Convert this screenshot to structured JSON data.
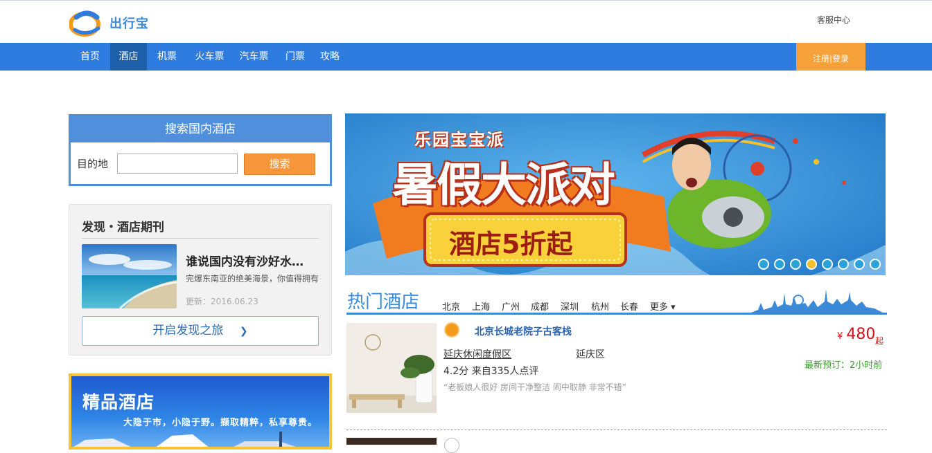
{
  "header": {
    "brand": "出行宝",
    "service_link": "客服中心"
  },
  "nav": {
    "items": [
      {
        "label": "首页"
      },
      {
        "label": "酒店",
        "active": true
      },
      {
        "label": "机票"
      },
      {
        "label": "火车票"
      },
      {
        "label": "汽车票"
      },
      {
        "label": "门票"
      },
      {
        "label": "攻略"
      }
    ],
    "login": "注册|登录"
  },
  "search": {
    "title": "搜索国内酒店",
    "label": "目的地",
    "value": "",
    "button": "搜索"
  },
  "discover": {
    "title": "发现・酒店期刊",
    "headline": "谁说国内没有沙好水…",
    "subtitle": "完爆东南亚的绝美海景，你值得拥有",
    "date": "更新：2016.06.23",
    "button": "开启发现之旅",
    "button_icon": "❯"
  },
  "boutique": {
    "title": "精品酒店",
    "subtitle": "大隐于市，小隐于野。撷取精粹，私享尊贵。"
  },
  "banner": {
    "line1": "乐园宝宝派",
    "line2": "暑假大派对",
    "promo": "酒店5折起",
    "active_dot": 3,
    "dot_count": 8
  },
  "hot": {
    "title": "热门酒店",
    "cities": [
      "北京",
      "上海",
      "广州",
      "成都",
      "深圳",
      "杭州",
      "长春"
    ],
    "more": "更多 ▾"
  },
  "hotel": {
    "name": "北京长城老院子古客栈",
    "type": "延庆休闲度假区",
    "area": "延庆区",
    "score": "4.2分 来自335人点评",
    "quote": "“老板娘人很好 房间干净整洁 闹中取静 非常不错”",
    "currency": "¥",
    "price": "480",
    "price_suffix": "起",
    "latest": "最新预订：2小时前"
  },
  "colors": {
    "nav_blue": "#2f7ce0",
    "nav_active": "#1d5fa9",
    "accent_orange": "#f7a13a",
    "price_red": "#d9121b"
  }
}
